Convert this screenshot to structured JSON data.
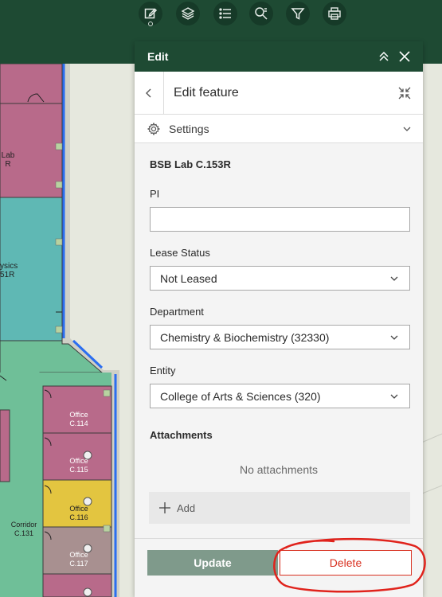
{
  "toolbar": {
    "tools": [
      {
        "icon": "edit-icon"
      },
      {
        "icon": "layers-icon"
      },
      {
        "icon": "list-icon"
      },
      {
        "icon": "search-icon"
      },
      {
        "icon": "filter-icon"
      },
      {
        "icon": "print-icon"
      }
    ]
  },
  "map": {
    "rooms": {
      "lab_partial": [
        "Lab",
        "R"
      ],
      "physics_partial": [
        "ysics",
        "51R"
      ],
      "office_114": [
        "Office",
        "C.114"
      ],
      "office_115": [
        "Office",
        "C.115"
      ],
      "office_116": [
        "Office",
        "C.116"
      ],
      "office_117": [
        "Office",
        "C.117"
      ],
      "corridor": [
        "Corridor",
        "C.131"
      ]
    }
  },
  "panel": {
    "header_title": "Edit",
    "feature_title": "Edit feature",
    "settings_label": "Settings",
    "feature_name": "BSB Lab C.153R",
    "fields": {
      "pi": {
        "label": "PI",
        "value": ""
      },
      "lease_status": {
        "label": "Lease Status",
        "value": "Not Leased"
      },
      "department": {
        "label": "Department",
        "value": "Chemistry & Biochemistry (32330)"
      },
      "entity": {
        "label": "Entity",
        "value": "College of Arts & Sciences (320)"
      }
    },
    "attachments": {
      "title": "Attachments",
      "empty_text": "No attachments",
      "add_label": "Add"
    },
    "footer": {
      "update_label": "Update",
      "delete_label": "Delete"
    }
  },
  "colors": {
    "header_green": "#1e4a33",
    "update_bg": "#7f9a8b",
    "delete_red": "#d83020",
    "annotation_red": "#e0231c"
  }
}
